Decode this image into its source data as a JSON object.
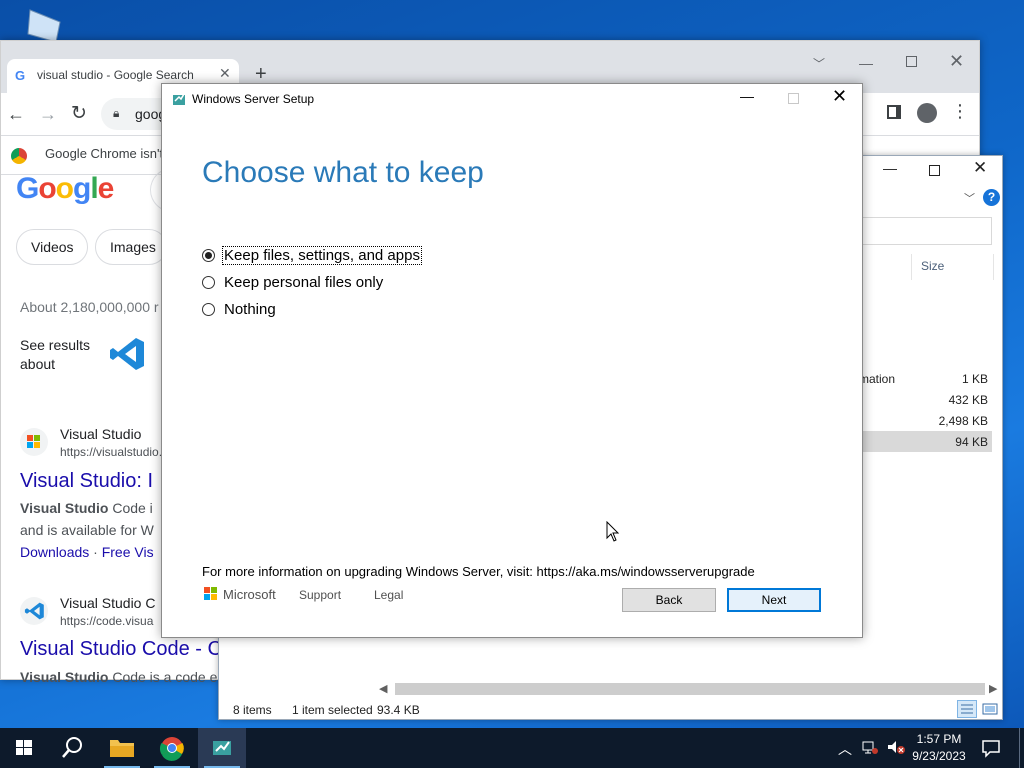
{
  "chrome": {
    "tab_title": "visual studio - Google Search",
    "tab_favicon": "G",
    "new_tab_label": "+",
    "url": "goog",
    "infobar_text": "Google Chrome isn't",
    "icons": [
      "back-icon",
      "forward-icon",
      "reload-icon",
      "lock-icon",
      "side-panel-icon",
      "profile-icon",
      "menu-icon"
    ]
  },
  "google": {
    "logo": {
      "g1": "G",
      "o1": "o",
      "o2": "o",
      "g2": "g",
      "l": "l",
      "e": "e"
    },
    "chips": [
      "Videos",
      "Images"
    ],
    "results_stats": "About 2,180,000,000 r",
    "see_results": "See results about",
    "results": [
      {
        "site": "Visual Studio",
        "url": "https://visualstudio.",
        "title": "Visual Studio: I",
        "snippet_bold": "Visual Studio",
        "snippet_rest": " Code i",
        "snippet2": "and is available for W",
        "link1": "Downloads",
        "sep": " · ",
        "link2": "Free Vis"
      },
      {
        "site": "Visual Studio C",
        "url": "https://code.visua",
        "title": "Visual Studio Code - C",
        "snippet_bold": "Visual Studio",
        "snippet_rest": " Code is a code editor redefined and optimized for building and debugging modern"
      }
    ]
  },
  "explorer": {
    "column_size": "Size",
    "rows": [
      {
        "type": "mation",
        "size": "1 KB"
      },
      {
        "type": "",
        "size": "432 KB"
      },
      {
        "type": "",
        "size": "2,498 KB"
      },
      {
        "type": "",
        "size": "94 KB"
      }
    ],
    "status_items": "8 items",
    "status_selected": "1 item selected",
    "status_size": "93.4 KB",
    "help": "?"
  },
  "setup": {
    "window_title": "Windows Server Setup",
    "heading": "Choose what to keep",
    "options": [
      {
        "label": "Keep files, settings, and apps",
        "selected": true
      },
      {
        "label": "Keep personal files only",
        "selected": false
      },
      {
        "label": "Nothing",
        "selected": false
      }
    ],
    "info": "For more information on upgrading Windows Server, visit: https://aka.ms/windowsserverupgrade",
    "microsoft": "Microsoft",
    "support": "Support",
    "legal": "Legal",
    "back": "Back",
    "next": "Next",
    "accent_color": "#2a7ab8"
  },
  "taskbar": {
    "time": "1:57 PM",
    "date": "9/23/2023",
    "apps": [
      "file-explorer-icon",
      "chrome-icon",
      "windows-server-setup-icon"
    ]
  }
}
